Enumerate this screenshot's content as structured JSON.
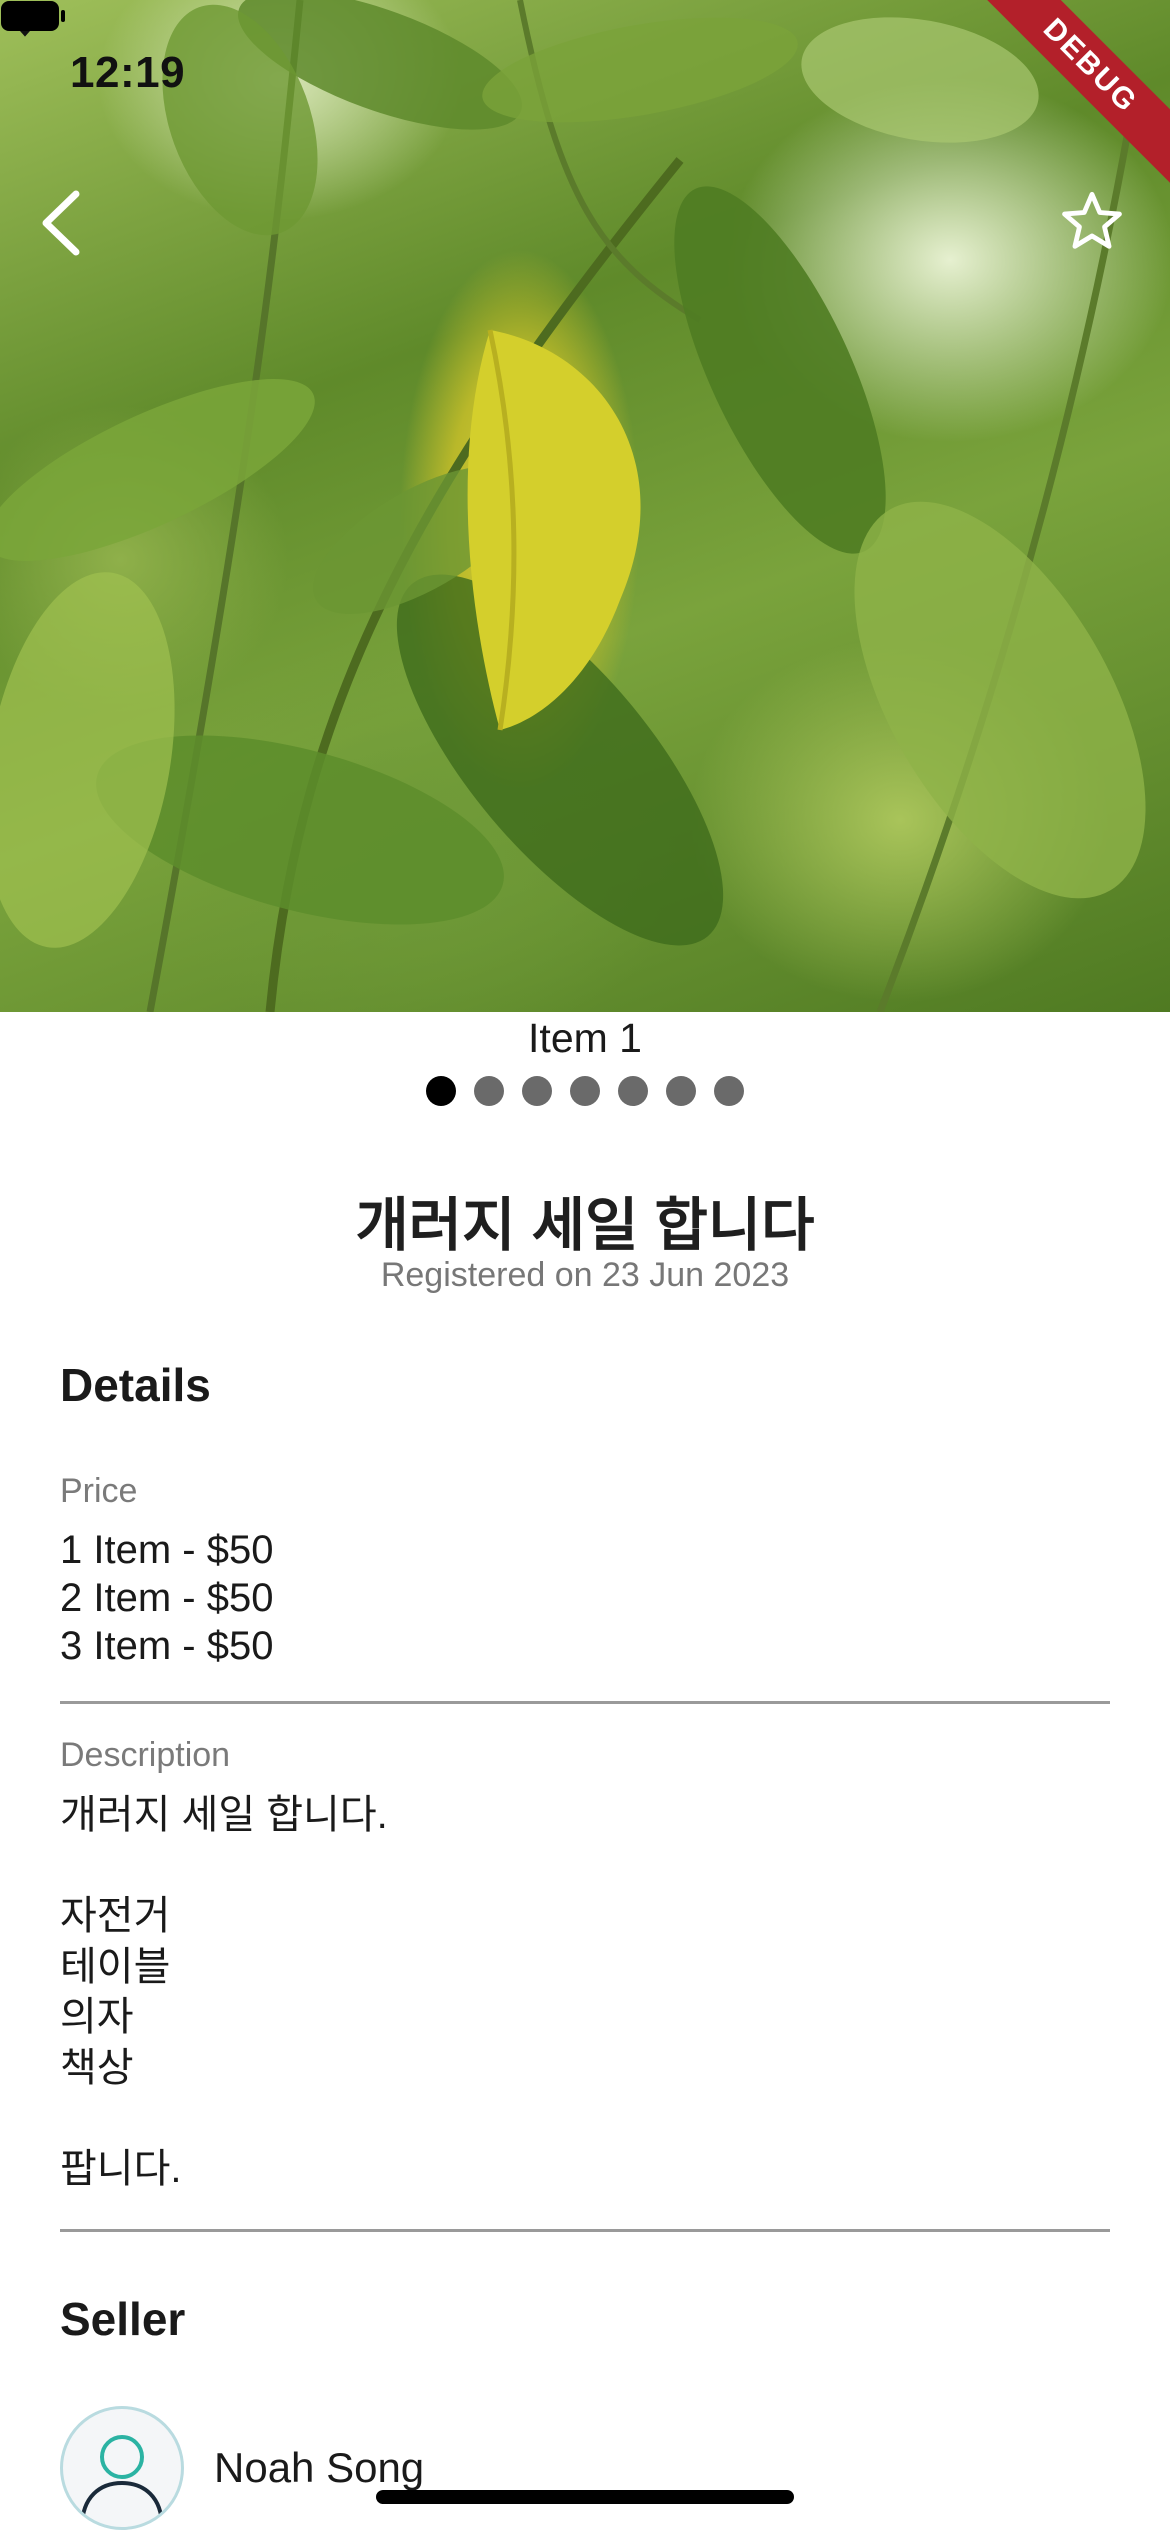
{
  "status_bar": {
    "time": "12:19",
    "debug_label": "DEBUG"
  },
  "header": {
    "back_icon": "chevron-left-icon",
    "favorite_icon": "star-outline-icon"
  },
  "carousel": {
    "caption": "Item 1",
    "page_count": 7,
    "active_index": 0
  },
  "item": {
    "title": "개러지 세일 합니다",
    "registered": "Registered on 23 Jun 2023"
  },
  "details": {
    "heading": "Details",
    "price_label": "Price",
    "prices": [
      "1 Item - $50",
      "2 Item - $50",
      "3 Item - $50"
    ],
    "description_label": "Description",
    "description": "개러지 세일 합니다.\n\n자전거\n테이블\n의자\n책상\n\n팝니다."
  },
  "seller": {
    "heading": "Seller",
    "name": "Noah Song",
    "avatar_icon": "user-avatar-icon"
  },
  "colors": {
    "debug_banner": "#b3202a",
    "dot_active": "#000000",
    "dot_inactive": "#6a6a6a",
    "divider": "#9a9a9a",
    "avatar_ring": "#b9dbe0",
    "avatar_figure": "#2bb3a3"
  }
}
